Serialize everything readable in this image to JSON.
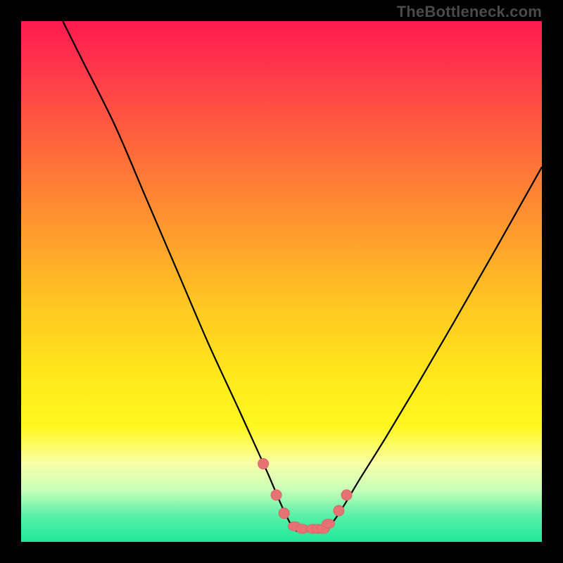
{
  "watermark": "TheBottleneck.com",
  "chart_data": {
    "type": "line",
    "title": "",
    "xlabel": "",
    "ylabel": "",
    "xlim": [
      0,
      100
    ],
    "ylim": [
      0,
      100
    ],
    "grid": false,
    "legend": false,
    "background_gradient": {
      "top": "#ff1a4f",
      "bottom": "#1ee89a"
    },
    "series": [
      {
        "name": "left-curve",
        "x": [
          8,
          12,
          18,
          24,
          30,
          36,
          42,
          47,
          50,
          52,
          53
        ],
        "y": [
          100,
          92,
          80,
          66,
          52,
          38,
          25,
          14,
          7,
          3,
          2
        ]
      },
      {
        "name": "right-curve",
        "x": [
          58,
          60,
          62,
          65,
          70,
          76,
          83,
          91,
          100
        ],
        "y": [
          2,
          4,
          7,
          12,
          20,
          30,
          42,
          56,
          72
        ]
      }
    ],
    "dots": {
      "name": "highlight-dots",
      "x": [
        46.5,
        49,
        50.5,
        52.5,
        54,
        56,
        57,
        58,
        59,
        61,
        62.5
      ],
      "y": [
        15,
        9,
        5.5,
        3,
        2.5,
        2.5,
        2.5,
        2.5,
        3.5,
        6,
        9
      ]
    }
  }
}
